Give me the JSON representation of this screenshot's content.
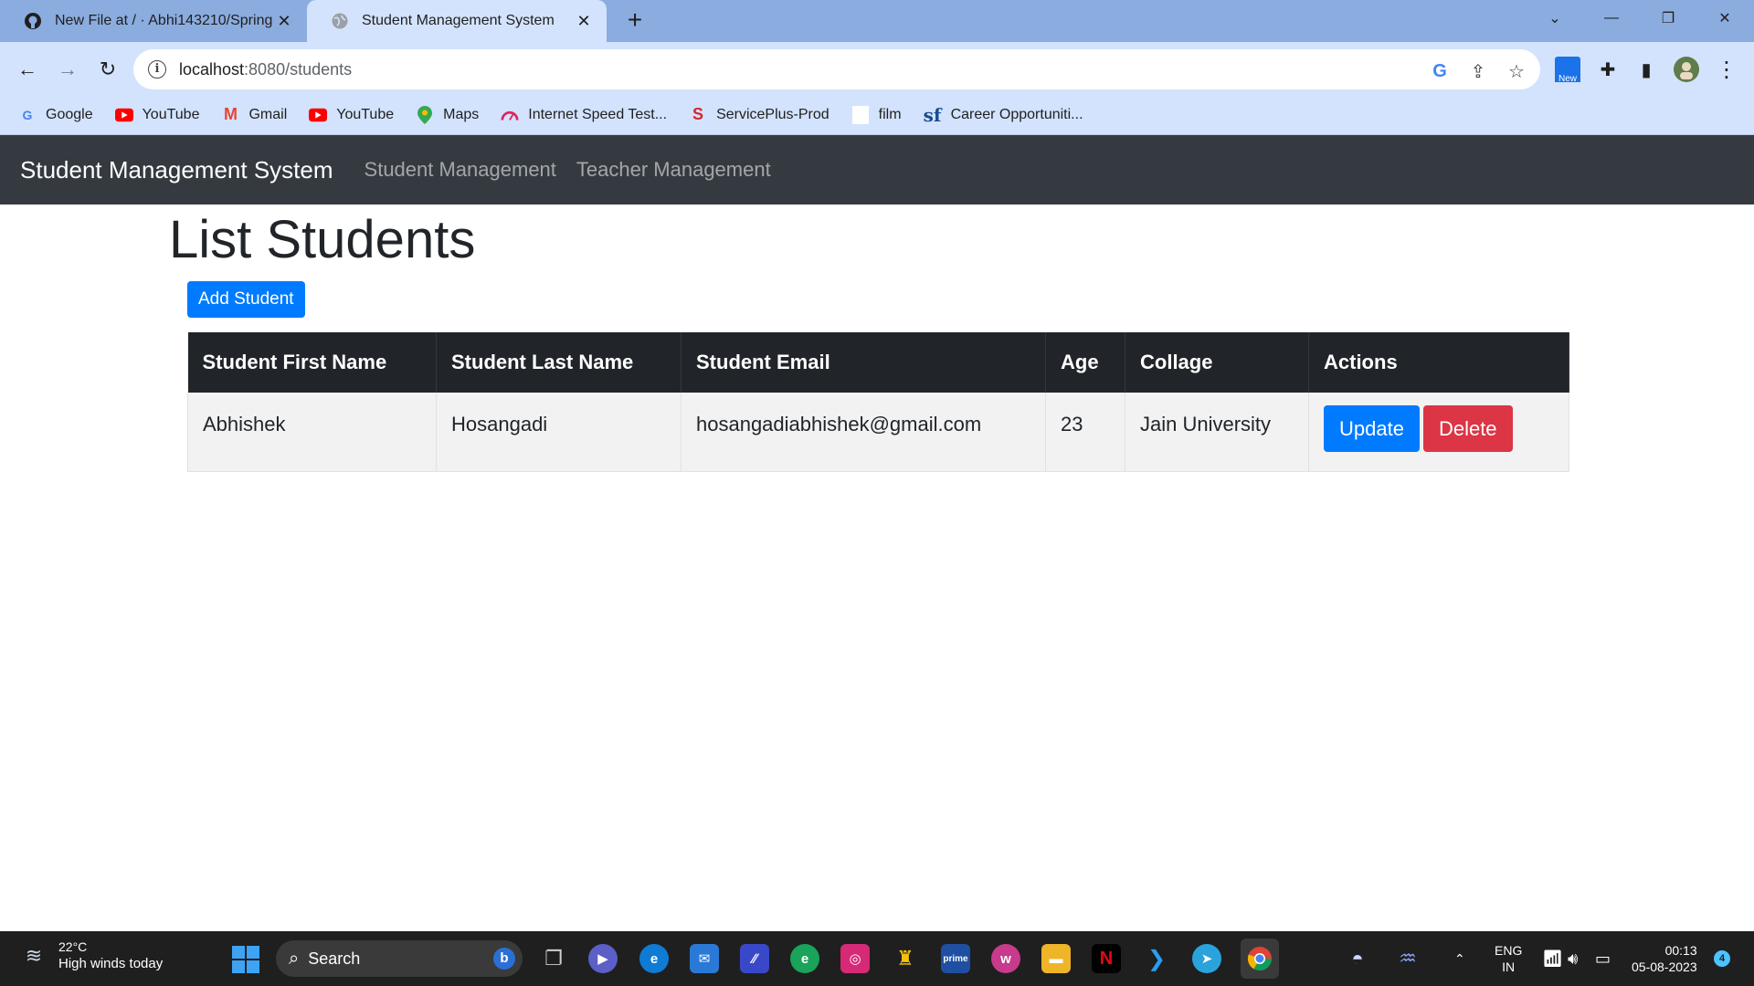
{
  "browser": {
    "tabs": [
      {
        "title": "New File at / · Abhi143210/Spring",
        "favicon": "github-icon",
        "active": false
      },
      {
        "title": "Student Management System",
        "favicon": "globe-icon",
        "active": true
      }
    ],
    "url_host": "localhost",
    "url_rest": ":8080/students",
    "extension_badge": "New",
    "bookmarks": [
      {
        "label": "Google",
        "icon": "google-icon",
        "color": "#4285f4"
      },
      {
        "label": "YouTube",
        "icon": "youtube-icon",
        "color": "#ff0000"
      },
      {
        "label": "Gmail",
        "icon": "gmail-icon",
        "color": "#ea4335"
      },
      {
        "label": "YouTube",
        "icon": "youtube-icon",
        "color": "#ff0000"
      },
      {
        "label": "Maps",
        "icon": "maps-icon",
        "color": "#34a853"
      },
      {
        "label": "Internet Speed Test...",
        "icon": "speedtest-icon",
        "color": "#e0245e"
      },
      {
        "label": "ServicePlus-Prod",
        "icon": "serviceplus-icon",
        "color": "#d6262f"
      },
      {
        "label": "film",
        "icon": "blank-page-icon",
        "color": "#ffffff"
      },
      {
        "label": "Career Opportuniti...",
        "icon": "successfactors-icon",
        "color": "#1a4d8f"
      }
    ]
  },
  "app": {
    "brand": "Student Management System",
    "nav": [
      "Student Management",
      "Teacher Management"
    ],
    "page_title": "List Students",
    "add_button": "Add Student",
    "table": {
      "headers": [
        "Student First Name",
        "Student Last Name",
        "Student Email",
        "Age",
        "Collage",
        "Actions"
      ],
      "rows": [
        {
          "first_name": "Abhishek",
          "last_name": "Hosangadi",
          "email": "hosangadiabhishek@gmail.com",
          "age": "23",
          "collage": "Jain University",
          "update_label": "Update",
          "delete_label": "Delete"
        }
      ]
    },
    "colors": {
      "navbar": "#343a40",
      "primary": "#007bff",
      "danger": "#dc3545",
      "table_head": "#212529"
    }
  },
  "taskbar": {
    "weather_temp": "22°C",
    "weather_desc": "High winds today",
    "search_label": "Search",
    "lang_top": "ENG",
    "lang_bottom": "IN",
    "time": "00:13",
    "date": "05-08-2023",
    "notifications": "4"
  }
}
